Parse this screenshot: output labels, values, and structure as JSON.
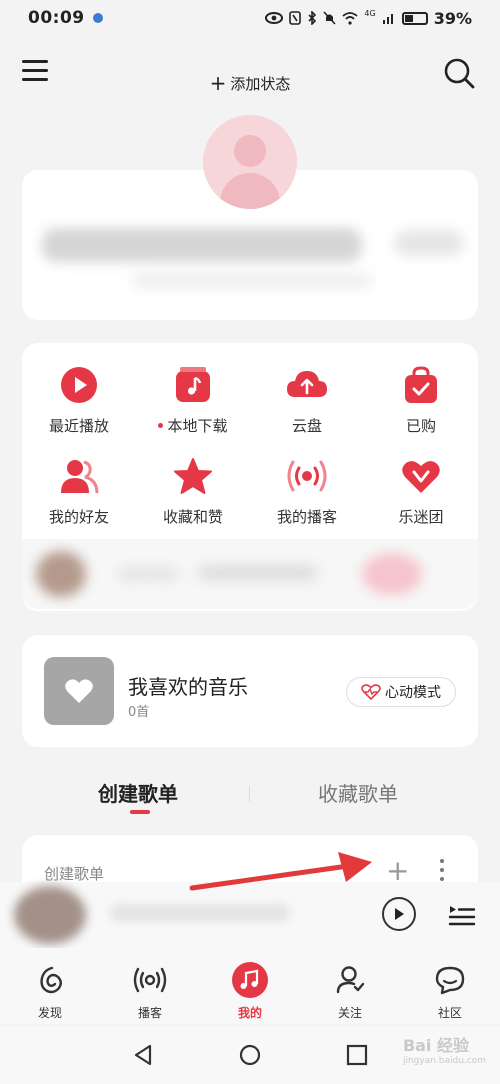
{
  "status_bar": {
    "time": "00:09",
    "network": "4G",
    "battery_text": "39%"
  },
  "header": {
    "add_status_label": "添加状态"
  },
  "quick_actions": [
    {
      "label": "最近播放",
      "icon": "play-icon",
      "dot": false
    },
    {
      "label": "本地下载",
      "icon": "music-file-icon",
      "dot": true
    },
    {
      "label": "云盘",
      "icon": "cloud-upload-icon",
      "dot": false
    },
    {
      "label": "已购",
      "icon": "shopping-bag-icon",
      "dot": false
    },
    {
      "label": "我的好友",
      "icon": "friends-icon",
      "dot": false
    },
    {
      "label": "收藏和赞",
      "icon": "star-icon",
      "dot": false
    },
    {
      "label": "我的播客",
      "icon": "podcast-icon",
      "dot": false
    },
    {
      "label": "乐迷团",
      "icon": "fan-heart-icon",
      "dot": false
    }
  ],
  "favorite": {
    "title": "我喜欢的音乐",
    "count": "0首",
    "mode_label": "心动模式"
  },
  "tabs": {
    "create": "创建歌单",
    "collect": "收藏歌单"
  },
  "playlist_section": {
    "header_label": "创建歌单",
    "add_symbol": "+"
  },
  "bottom_nav": [
    {
      "label": "发现",
      "icon": "discover-icon",
      "active": false
    },
    {
      "label": "播客",
      "icon": "podcast-nav-icon",
      "active": false
    },
    {
      "label": "我的",
      "icon": "music-note-icon",
      "active": true
    },
    {
      "label": "关注",
      "icon": "follow-icon",
      "active": false
    },
    {
      "label": "社区",
      "icon": "community-icon",
      "active": false
    }
  ],
  "watermark": {
    "text": "Bai 经验",
    "sub": "jingyan.baidu.com"
  },
  "colors": {
    "accent": "#e53846",
    "background": "#f3f3f3",
    "card": "#ffffff"
  }
}
